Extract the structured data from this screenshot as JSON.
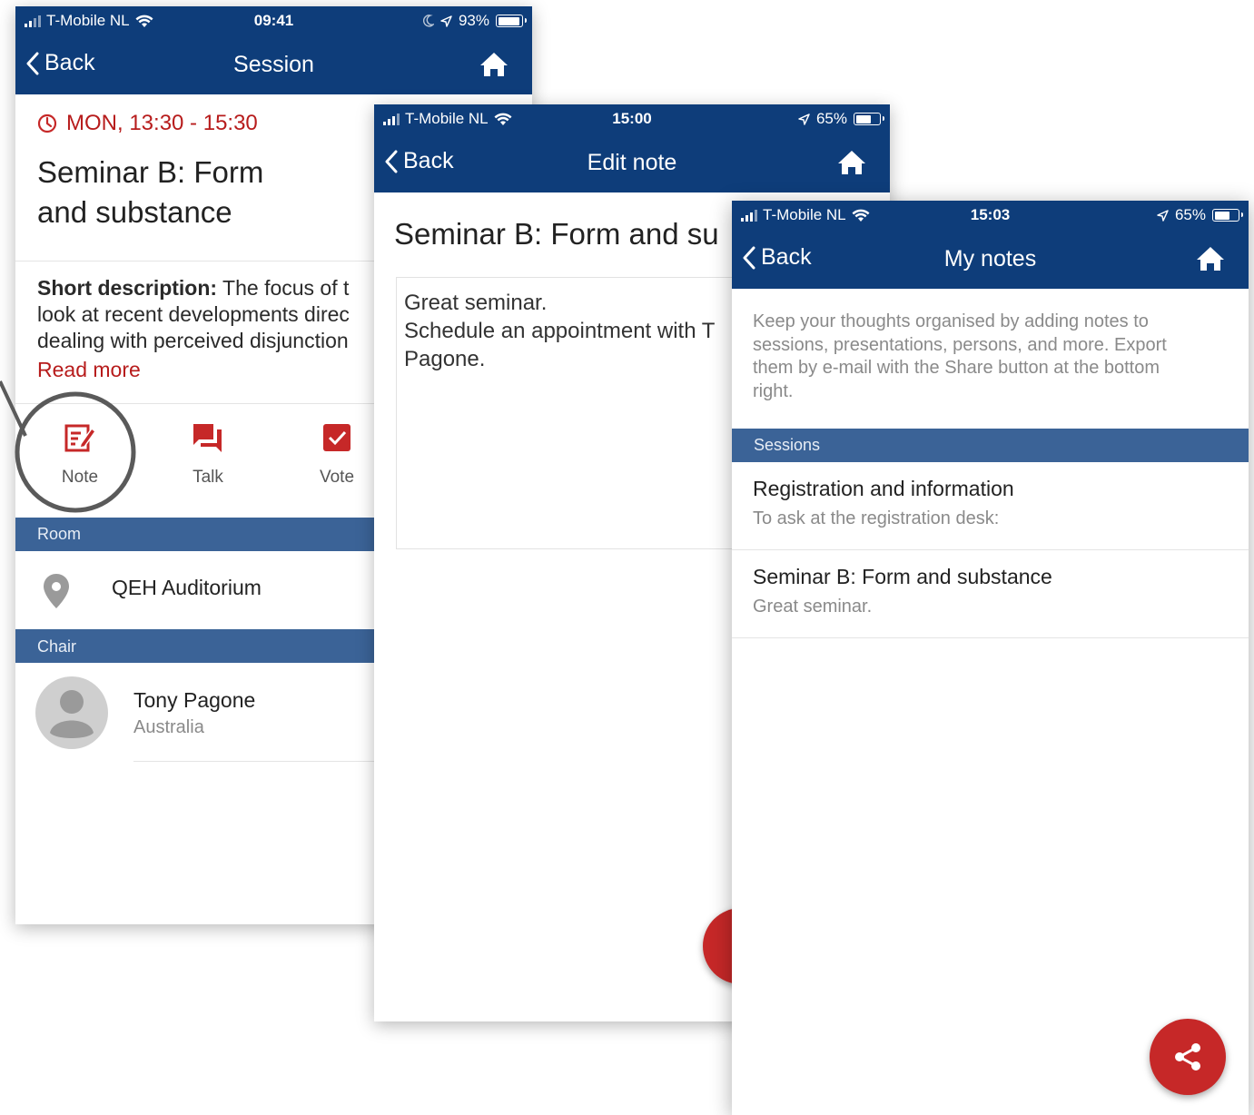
{
  "colors": {
    "nav_bar": "#0e3d7a",
    "section_header": "#3b6397",
    "accent_red": "#c62828"
  },
  "screen1": {
    "status": {
      "carrier": "T-Mobile NL",
      "time": "09:41",
      "battery": "93%",
      "battery_level": 0.93
    },
    "nav": {
      "back_label": "Back",
      "title": "Session"
    },
    "session_time": "MON, 13:30 - 15:30",
    "session_title_line1": "Seminar B: Form",
    "session_title_line2": "and substance",
    "description_label": "Short description:",
    "description_line1": "The focus of t",
    "description_line2": "look at recent developments direc",
    "description_line3": "dealing with perceived disjunction",
    "read_more": "Read more",
    "actions": [
      {
        "label": "Note",
        "icon": "note-edit-icon"
      },
      {
        "label": "Talk",
        "icon": "chat-icon"
      },
      {
        "label": "Vote",
        "icon": "checkbox-icon"
      }
    ],
    "room_header": "Room",
    "room_name": "QEH Auditorium",
    "chair_header": "Chair",
    "chair_name": "Tony Pagone",
    "chair_country": "Australia"
  },
  "screen2": {
    "status": {
      "carrier": "T-Mobile NL",
      "time": "15:00",
      "battery": "65%",
      "battery_level": 0.65
    },
    "nav": {
      "back_label": "Back",
      "title": "Edit note"
    },
    "note_title": "Seminar B: Form and su",
    "note_line1": "Great seminar.",
    "note_line2": "Schedule an appointment with T",
    "note_line3": "Pagone."
  },
  "screen3": {
    "status": {
      "carrier": "T-Mobile NL",
      "time": "15:03",
      "battery": "65%",
      "battery_level": 0.65
    },
    "nav": {
      "back_label": "Back",
      "title": "My notes"
    },
    "intro_line1": "Keep your thoughts organised by adding notes to",
    "intro_line2": "sessions, presentations, persons, and more. Export",
    "intro_line3": "them by e-mail with the Share button at the bottom",
    "intro_line4": "right.",
    "sessions_header": "Sessions",
    "notes": [
      {
        "title": "Registration and information",
        "preview": "To ask at the registration desk:"
      },
      {
        "title": "Seminar B: Form and substance",
        "preview": "Great seminar."
      }
    ]
  }
}
